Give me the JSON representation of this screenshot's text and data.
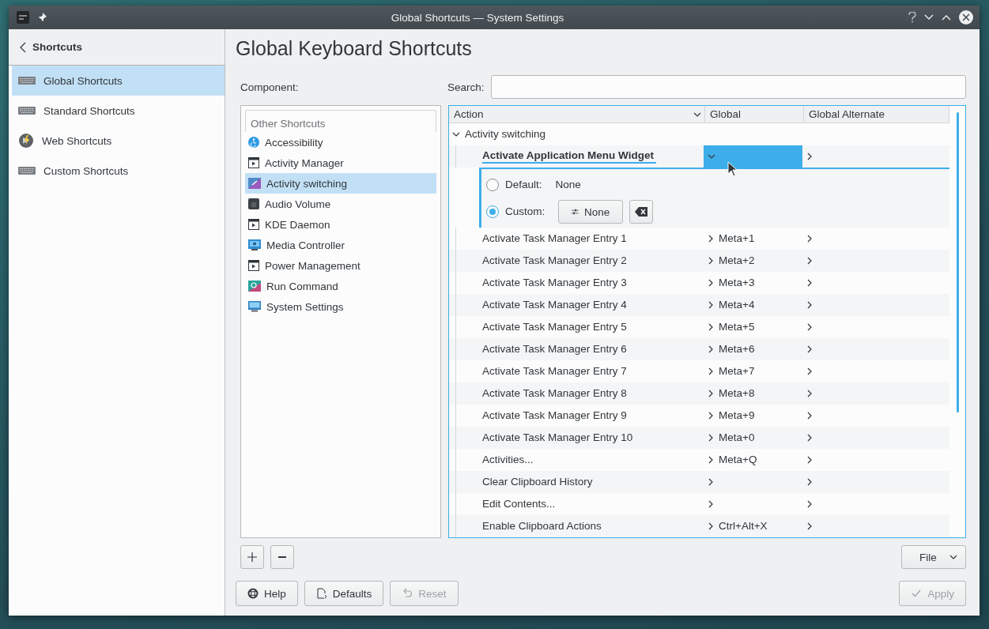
{
  "window": {
    "title": "Global Shortcuts — System Settings"
  },
  "sidebar": {
    "back_label": "Shortcuts",
    "items": [
      {
        "label": "Global Shortcuts",
        "selected": true
      },
      {
        "label": "Standard Shortcuts",
        "selected": false
      },
      {
        "label": "Web Shortcuts",
        "selected": false
      },
      {
        "label": "Custom Shortcuts",
        "selected": false
      }
    ]
  },
  "page_title": "Global Keyboard Shortcuts",
  "component_label": "Component:",
  "search_label": "Search:",
  "components": {
    "header": "Other Shortcuts",
    "items": [
      {
        "label": "Accessibility",
        "selected": false
      },
      {
        "label": "Activity Manager",
        "selected": false
      },
      {
        "label": "Activity switching",
        "selected": true
      },
      {
        "label": "Audio Volume",
        "selected": false
      },
      {
        "label": "KDE Daemon",
        "selected": false
      },
      {
        "label": "Media Controller",
        "selected": false
      },
      {
        "label": "Power Management",
        "selected": false
      },
      {
        "label": "Run Command",
        "selected": false
      },
      {
        "label": "System Settings",
        "selected": false
      }
    ]
  },
  "table": {
    "columns": [
      "Action",
      "Global",
      "Global Alternate"
    ],
    "groups": [
      {
        "label": "Activity switching",
        "expanded": true,
        "actions": [
          {
            "label": "Activate Application Menu Widget",
            "expanded": true,
            "editor": [
              {
                "kind": "text",
                "label": "Default:",
                "value": "None",
                "selected": false
              },
              {
                "kind": "button",
                "label": "Custom:",
                "value": "None",
                "selected": true
              }
            ]
          },
          {
            "label": "Activate Task Manager Entry 1",
            "expanded": false,
            "global": "Meta+1"
          },
          {
            "label": "Activate Task Manager Entry 2",
            "expanded": false,
            "global": "Meta+2"
          },
          {
            "label": "Activate Task Manager Entry 3",
            "expanded": false,
            "global": "Meta+3"
          },
          {
            "label": "Activate Task Manager Entry 4",
            "expanded": false,
            "global": "Meta+4"
          },
          {
            "label": "Activate Task Manager Entry 5",
            "expanded": false,
            "global": "Meta+5"
          },
          {
            "label": "Activate Task Manager Entry 6",
            "expanded": false,
            "global": "Meta+6"
          },
          {
            "label": "Activate Task Manager Entry 7",
            "expanded": false,
            "global": "Meta+7"
          },
          {
            "label": "Activate Task Manager Entry 8",
            "expanded": false,
            "global": "Meta+8"
          },
          {
            "label": "Activate Task Manager Entry 9",
            "expanded": false,
            "global": "Meta+9"
          },
          {
            "label": "Activate Task Manager Entry 10",
            "expanded": false,
            "global": "Meta+0"
          },
          {
            "label": "Activities...",
            "expanded": false,
            "global": "Meta+Q"
          },
          {
            "label": "Clear Clipboard History",
            "expanded": false
          },
          {
            "label": "Edit Contents...",
            "expanded": false
          },
          {
            "label": "Enable Clipboard Actions",
            "expanded": false,
            "global": "Ctrl+Alt+X"
          }
        ]
      }
    ]
  },
  "file_button": "File",
  "footer_buttons": [
    {
      "kind": "help",
      "label": "Help",
      "disabled": false
    },
    {
      "kind": "defaults",
      "label": "Defaults",
      "disabled": false
    },
    {
      "kind": "reset",
      "label": "Reset",
      "disabled": true
    },
    {
      "kind": "apply",
      "label": "Apply",
      "disabled": true
    }
  ]
}
